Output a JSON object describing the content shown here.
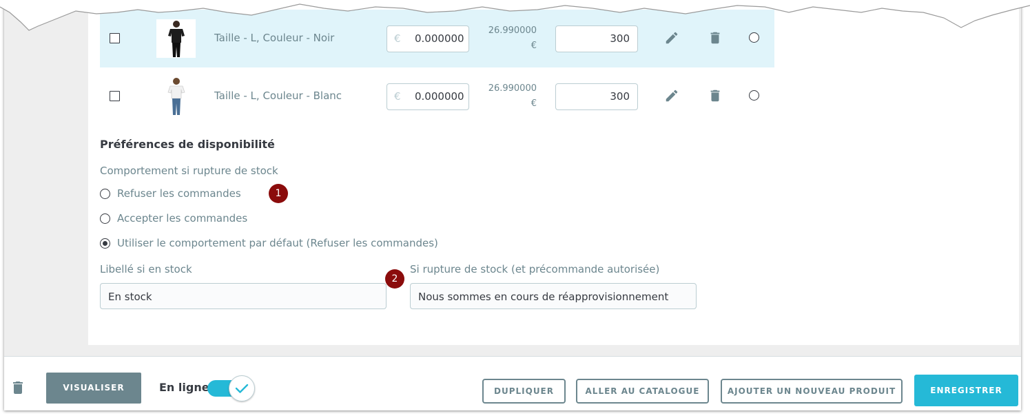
{
  "variants": {
    "currency_prefix": "€",
    "rows": [
      {
        "name": "Taille - L, Couleur - Noir",
        "price_impact": "0.000000",
        "final_price": "26.990000",
        "final_currency": "€",
        "quantity": "300",
        "selected": true,
        "thumb_color": "#1c1c1c"
      },
      {
        "name": "Taille - L, Couleur - Blanc",
        "price_impact": "0.000000",
        "final_price": "26.990000",
        "final_currency": "€",
        "quantity": "300",
        "selected": false,
        "thumb_color": "#f4f4f4"
      }
    ]
  },
  "availability": {
    "title": "Préférences de disponibilité",
    "oos_label": "Comportement si rupture de stock",
    "options": [
      {
        "label": "Refuser les commandes",
        "checked": false
      },
      {
        "label": "Accepter les commandes",
        "checked": false
      },
      {
        "label": "Utiliser le comportement par défaut (Refuser les commandes)",
        "checked": true
      }
    ],
    "in_stock_label": "Libellé si en stock",
    "in_stock_value": "En stock",
    "backorder_label": "Si rupture de stock (et précommande autorisée)",
    "backorder_value": "Nous sommes en cours de réapprovisionnement",
    "badges": [
      "1",
      "2"
    ]
  },
  "footer": {
    "preview_label": "VISUALISER",
    "online_label": "En ligne",
    "online_enabled": true,
    "duplicate_label": "DUPLIQUER",
    "catalog_label": "ALLER AU CATALOGUE",
    "new_product_label": "AJOUTER UN NOUVEAU PRODUIT",
    "save_label": "ENREGISTRER"
  },
  "colors": {
    "primary": "#25b9d7",
    "secondary": "#6c868e",
    "selected_row": "#e0f4fa",
    "badge": "#8b0c0c"
  }
}
